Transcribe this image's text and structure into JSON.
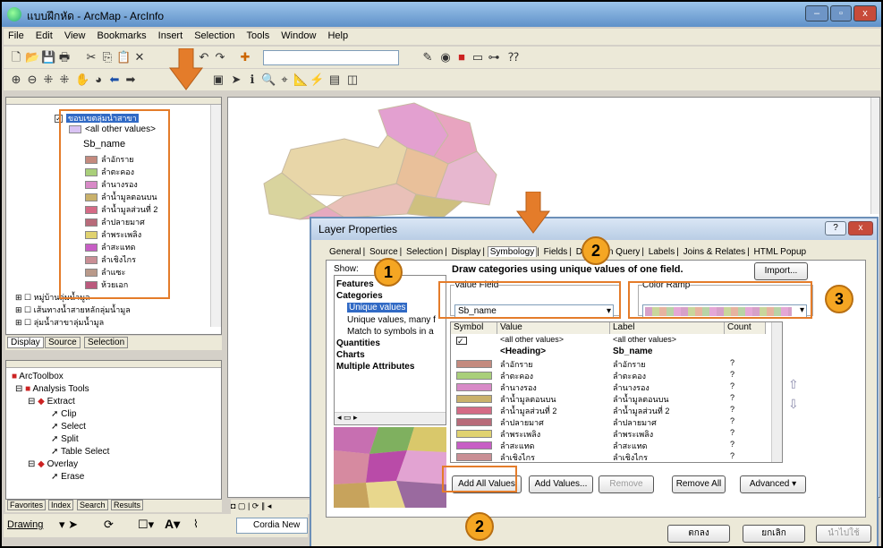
{
  "window": {
    "title": "แบบฝึกหัด - ArcMap - ArcInfo",
    "minimize": "–",
    "restore": "▫",
    "close": "x"
  },
  "menu": [
    "File",
    "Edit",
    "View",
    "Bookmarks",
    "Insert",
    "Selection",
    "Tools",
    "Window",
    "Help"
  ],
  "toc": {
    "layer_name": "ขอบเขตลุ่มน้ำสาขา",
    "all_other": "<all other values>",
    "field": "Sb_name",
    "items": [
      {
        "label": "ลำอักราย",
        "color": "#c48a7e"
      },
      {
        "label": "ลำตะคอง",
        "color": "#a9cf7a"
      },
      {
        "label": "ลำนางรอง",
        "color": "#d88ac7"
      },
      {
        "label": "ลำน้ำมูลตอนบน",
        "color": "#c9b16b"
      },
      {
        "label": "ลำน้ำมูลส่วนที่ 2",
        "color": "#d46b86"
      },
      {
        "label": "ลำปลายมาศ",
        "color": "#b86b7a"
      },
      {
        "label": "ลำพระเพลิง",
        "color": "#e0d270"
      },
      {
        "label": "ลำสะแทด",
        "color": "#c75ec5"
      },
      {
        "label": "ลำเชิงไกร",
        "color": "#c98f95"
      },
      {
        "label": "ลำแซะ",
        "color": "#b99a8a"
      },
      {
        "label": "ห้วยเอก",
        "color": "#bb5a7d"
      }
    ],
    "other_layers": [
      "หมู่บ้านลุ่มน้ำมูล",
      "เส้นทางน้ำสายหลักลุ่มน้ำมูล",
      "ลุ่มน้ำสาขาลุ่มน้ำมูล"
    ],
    "tabs": [
      "Display",
      "Source",
      "Selection"
    ]
  },
  "toolbox": {
    "root": "ArcToolbox",
    "analysis": "Analysis Tools",
    "extract": "Extract",
    "extract_tools": [
      "Clip",
      "Select",
      "Split",
      "Table Select"
    ],
    "overlay": "Overlay",
    "overlay_tools": [
      "Erase"
    ],
    "tabs": [
      "Favorites",
      "Index",
      "Search",
      "Results"
    ]
  },
  "drawing": {
    "label": "Drawing",
    "font": "Cordia New"
  },
  "dialog": {
    "title": "Layer Properties",
    "help": "?",
    "tabs": [
      "General",
      "Source",
      "Selection",
      "Display",
      "Symbology",
      "Fields",
      "Definition Query",
      "Labels",
      "Joins & Relates",
      "HTML Popup"
    ],
    "show_label": "Show:",
    "show_items": {
      "features": "Features",
      "categories": "Categories",
      "unique": "Unique values",
      "unique_many": "Unique values, many f",
      "match": "Match to symbols in a",
      "quantities": "Quantities",
      "charts": "Charts",
      "multi": "Multiple Attributes"
    },
    "heading": "Draw categories using unique values of one field.",
    "import": "Import...",
    "value_field_label": "Value Field",
    "value_field": "Sb_name",
    "color_ramp_label": "Color Ramp",
    "columns": {
      "symbol": "Symbol",
      "value": "Value",
      "label": "Label",
      "count": "Count"
    },
    "rows": [
      {
        "value": "<all other values>",
        "label": "<all other values>",
        "count": "",
        "color": "#c9a7e8"
      },
      {
        "value": "<Heading>",
        "label": "Sb_name",
        "count": "",
        "color": ""
      },
      {
        "value": "ลำอักราย",
        "label": "ลำอักราย",
        "count": "?",
        "color": "#c48a7e"
      },
      {
        "value": "ลำตะคอง",
        "label": "ลำตะคอง",
        "count": "?",
        "color": "#a9cf7a"
      },
      {
        "value": "ลำนางรอง",
        "label": "ลำนางรอง",
        "count": "?",
        "color": "#d88ac7"
      },
      {
        "value": "ลำน้ำมูลตอนบน",
        "label": "ลำน้ำมูลตอนบน",
        "count": "?",
        "color": "#c9b16b"
      },
      {
        "value": "ลำน้ำมูลส่วนที่ 2",
        "label": "ลำน้ำมูลส่วนที่ 2",
        "count": "?",
        "color": "#d46b86"
      },
      {
        "value": "ลำปลายมาศ",
        "label": "ลำปลายมาศ",
        "count": "?",
        "color": "#b86b7a"
      },
      {
        "value": "ลำพระเพลิง",
        "label": "ลำพระเพลิง",
        "count": "?",
        "color": "#e0d270"
      },
      {
        "value": "ลำสะแทด",
        "label": "ลำสะแทด",
        "count": "?",
        "color": "#c75ec5"
      },
      {
        "value": "ลำเชิงไกร",
        "label": "ลำเชิงไกร",
        "count": "?",
        "color": "#c98f95"
      }
    ],
    "buttons": {
      "add_all": "Add All Values",
      "add": "Add Values...",
      "remove": "Remove",
      "remove_all": "Remove All",
      "advanced": "Advanced",
      "ok": "ตกลง",
      "cancel": "ยกเลิก",
      "apply": "นำไปใช้"
    }
  },
  "badges": {
    "one": "1",
    "two_top": "2",
    "two_bottom": "2",
    "three": "3"
  },
  "colors": {
    "highlight": "#e47c2a",
    "badge": "#f5a623",
    "selection": "#316ac5"
  }
}
